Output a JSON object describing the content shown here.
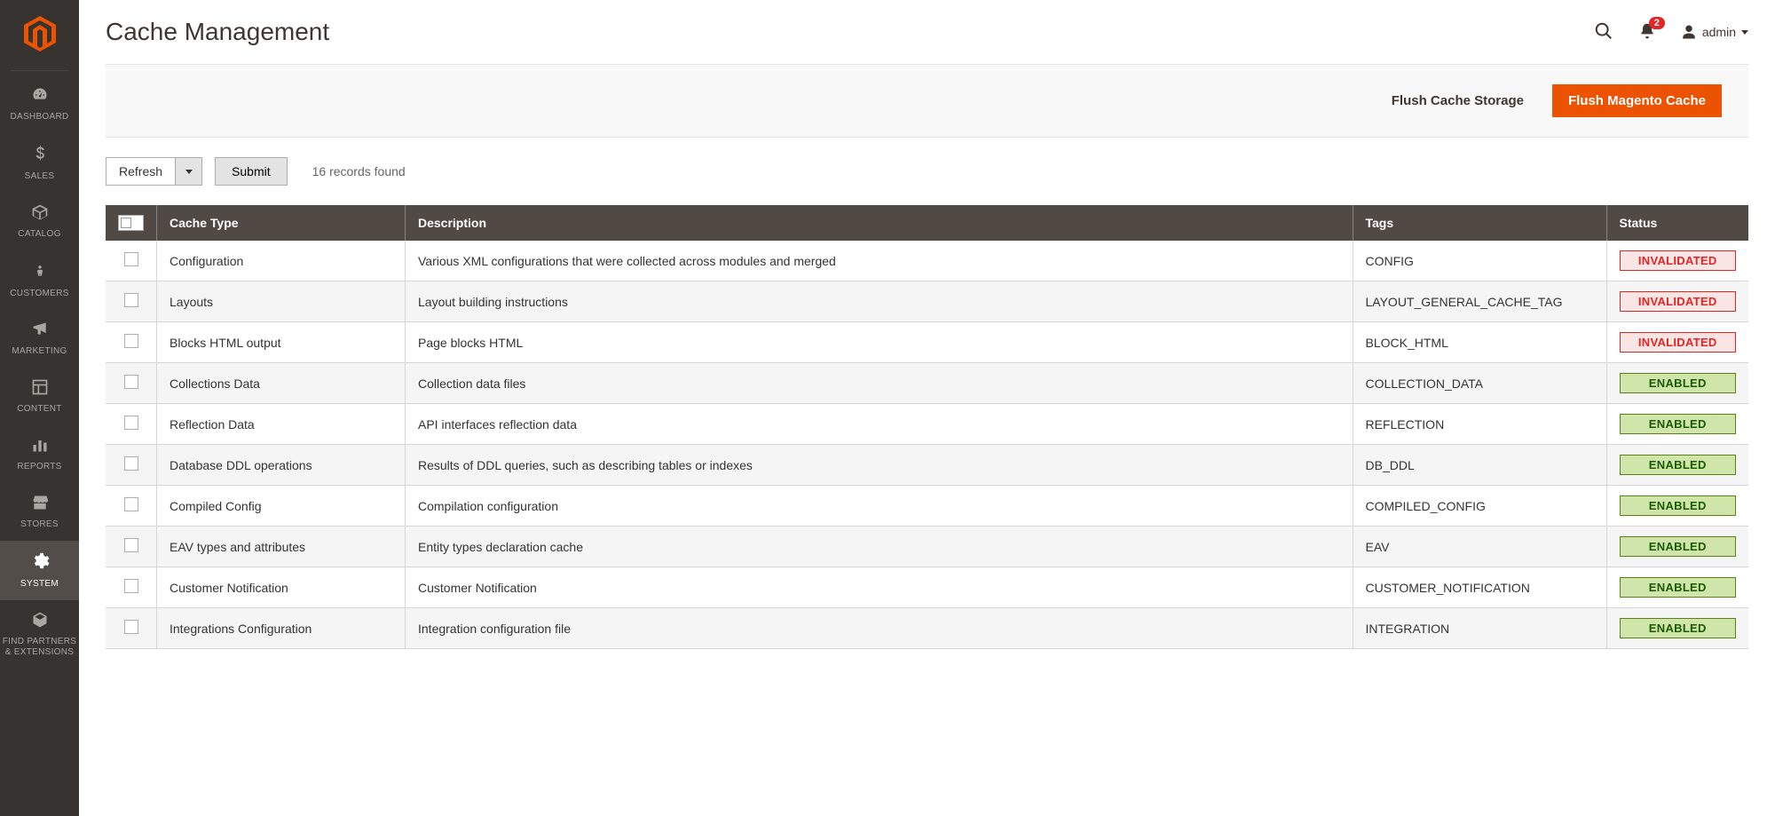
{
  "page": {
    "title": "Cache Management"
  },
  "header": {
    "notification_count": "2",
    "username": "admin"
  },
  "sidebar": {
    "items": [
      {
        "label": "DASHBOARD",
        "icon": "dashboard"
      },
      {
        "label": "SALES",
        "icon": "dollar"
      },
      {
        "label": "CATALOG",
        "icon": "box"
      },
      {
        "label": "CUSTOMERS",
        "icon": "person"
      },
      {
        "label": "MARKETING",
        "icon": "megaphone"
      },
      {
        "label": "CONTENT",
        "icon": "layout"
      },
      {
        "label": "REPORTS",
        "icon": "barchart"
      },
      {
        "label": "STORES",
        "icon": "storefront"
      },
      {
        "label": "SYSTEM",
        "icon": "gear",
        "active": true
      },
      {
        "label": "FIND PARTNERS & EXTENSIONS",
        "icon": "cube"
      }
    ]
  },
  "actions": {
    "flush_storage": "Flush Cache Storage",
    "flush_magento": "Flush Magento Cache"
  },
  "toolbar": {
    "mass_action": "Refresh",
    "submit": "Submit",
    "records": "16 records found"
  },
  "columns": {
    "type": "Cache Type",
    "desc": "Description",
    "tags": "Tags",
    "status": "Status"
  },
  "rows": [
    {
      "type": "Configuration",
      "desc": "Various XML configurations that were collected across modules and merged",
      "tags": "CONFIG",
      "status": "INVALIDATED"
    },
    {
      "type": "Layouts",
      "desc": "Layout building instructions",
      "tags": "LAYOUT_GENERAL_CACHE_TAG",
      "status": "INVALIDATED"
    },
    {
      "type": "Blocks HTML output",
      "desc": "Page blocks HTML",
      "tags": "BLOCK_HTML",
      "status": "INVALIDATED"
    },
    {
      "type": "Collections Data",
      "desc": "Collection data files",
      "tags": "COLLECTION_DATA",
      "status": "ENABLED"
    },
    {
      "type": "Reflection Data",
      "desc": "API interfaces reflection data",
      "tags": "REFLECTION",
      "status": "ENABLED"
    },
    {
      "type": "Database DDL operations",
      "desc": "Results of DDL queries, such as describing tables or indexes",
      "tags": "DB_DDL",
      "status": "ENABLED"
    },
    {
      "type": "Compiled Config",
      "desc": "Compilation configuration",
      "tags": "COMPILED_CONFIG",
      "status": "ENABLED"
    },
    {
      "type": "EAV types and attributes",
      "desc": "Entity types declaration cache",
      "tags": "EAV",
      "status": "ENABLED"
    },
    {
      "type": "Customer Notification",
      "desc": "Customer Notification",
      "tags": "CUSTOMER_NOTIFICATION",
      "status": "ENABLED"
    },
    {
      "type": "Integrations Configuration",
      "desc": "Integration configuration file",
      "tags": "INTEGRATION",
      "status": "ENABLED"
    }
  ]
}
